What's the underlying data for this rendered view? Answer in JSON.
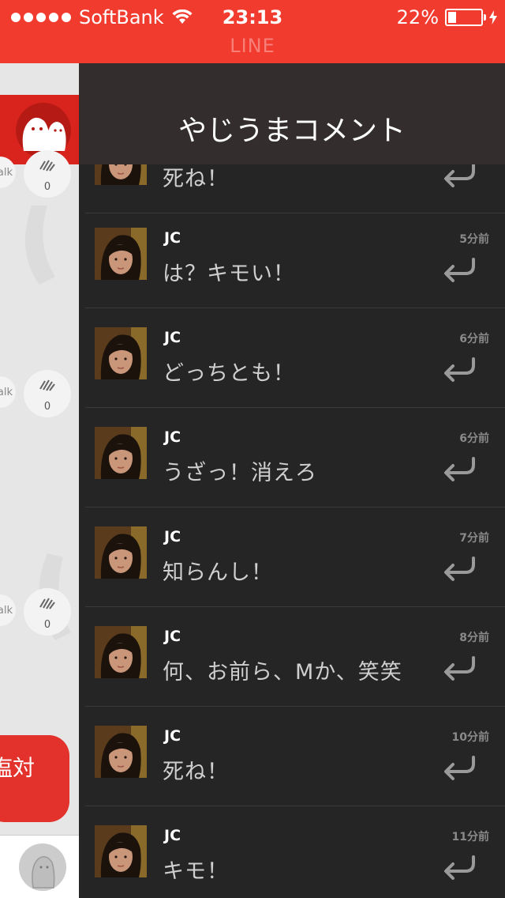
{
  "status_bar": {
    "carrier": "SoftBank",
    "time": "23:13",
    "battery": "22%",
    "battery_level": 0.22,
    "app_name": "LINE"
  },
  "behind": {
    "talk_fragment": "alk",
    "counts": [
      "0",
      "0",
      "0"
    ],
    "bubble_text": "塩対"
  },
  "panel": {
    "title": "やじうまコメント",
    "comments": [
      {
        "user": "",
        "time": "",
        "text": "死ね！"
      },
      {
        "user": "JC",
        "time": "5分前",
        "text": "は？キモい！"
      },
      {
        "user": "JC",
        "time": "6分前",
        "text": "どっちとも！"
      },
      {
        "user": "JC",
        "time": "6分前",
        "text": "うざっ！消えろ"
      },
      {
        "user": "JC",
        "time": "7分前",
        "text": "知らんし！"
      },
      {
        "user": "JC",
        "time": "8分前",
        "text": "何、お前ら、Mか、笑笑"
      },
      {
        "user": "JC",
        "time": "10分前",
        "text": "死ね！"
      },
      {
        "user": "JC",
        "time": "11分前",
        "text": "キモ！"
      }
    ]
  },
  "colors": {
    "brand_red": "#f23b2f",
    "panel_bg": "#252525",
    "header_bg": "#332e2d"
  },
  "icons": [
    "wifi-icon",
    "battery-icon",
    "charging-icon",
    "ghost-icon",
    "clap-icon",
    "reply-icon",
    "avatar-icon"
  ]
}
